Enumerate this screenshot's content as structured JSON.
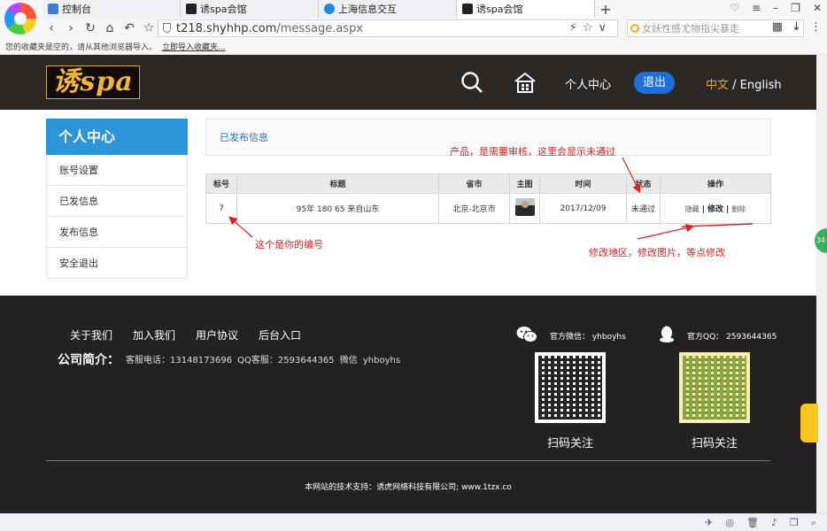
{
  "browser": {
    "tabs": [
      {
        "label": "控制台",
        "active": false
      },
      {
        "label": "诱spa会馆",
        "active": false
      },
      {
        "label": "上海信息交互",
        "active": false
      },
      {
        "label": "诱spa会馆",
        "active": true
      }
    ],
    "new_tab_label": "+",
    "address": {
      "host": "t218.shyhhp.com",
      "path": "/message.aspx"
    },
    "search_placeholder": "女妖性感尤物指尖暴走",
    "favbar_text": "您的收藏夹是空的，请从其他浏览器导入。",
    "favbar_link": "立即导入收藏夹..."
  },
  "header": {
    "brand": "诱spa",
    "center_label": "个人中心",
    "logout_label": "退出",
    "lang_zh": "中文",
    "lang_sep": " / ",
    "lang_en": "English"
  },
  "sidebar": {
    "title": "个人中心",
    "items": [
      {
        "label": "账号设置"
      },
      {
        "label": "已发信息"
      },
      {
        "label": "发布信息"
      },
      {
        "label": "安全退出"
      }
    ]
  },
  "content": {
    "title": "已发布信息",
    "table": {
      "headers": [
        "标号",
        "标题",
        "省市",
        "主图",
        "时间",
        "状态",
        "操作"
      ],
      "rows": [
        {
          "id": "7",
          "title": "95年 180 65 来自山东",
          "city": "北京-北京市",
          "time": "2017/12/09",
          "status": "未通过",
          "op_hide": "隐藏",
          "op_edit": "修改",
          "op_delete": "删除"
        }
      ]
    }
  },
  "annotations": {
    "review": "产品，是需要审核，这里会显示未通过",
    "number": "这个是你的编号",
    "edit": "修改地区，修改图片，等点修改"
  },
  "footer": {
    "links": [
      "关于我们",
      "加入我们",
      "用户协议",
      "后台入口"
    ],
    "intro_label": "公司简介：",
    "contact": "客服电话：13148173696    QQ客服：2593644365  微信 yhboyhs",
    "wechat": "官方微信：  yhboyhs",
    "qq": "官方QQ：  2593644365",
    "qr_label_1": "扫码关注",
    "qr_label_2": "扫码关注",
    "copyright": "本网站的技术支持：诱虎网络科技有限公司; www.1tzx.co"
  },
  "floats": {
    "green_badge": "34"
  },
  "colors": {
    "accent_blue": "#2b95d8",
    "logout_blue": "#1e6fd9",
    "alert_red": "#e02020",
    "lang_orange": "#f5a623",
    "header_bg": "#2c2826",
    "footer_bg": "#242122"
  }
}
